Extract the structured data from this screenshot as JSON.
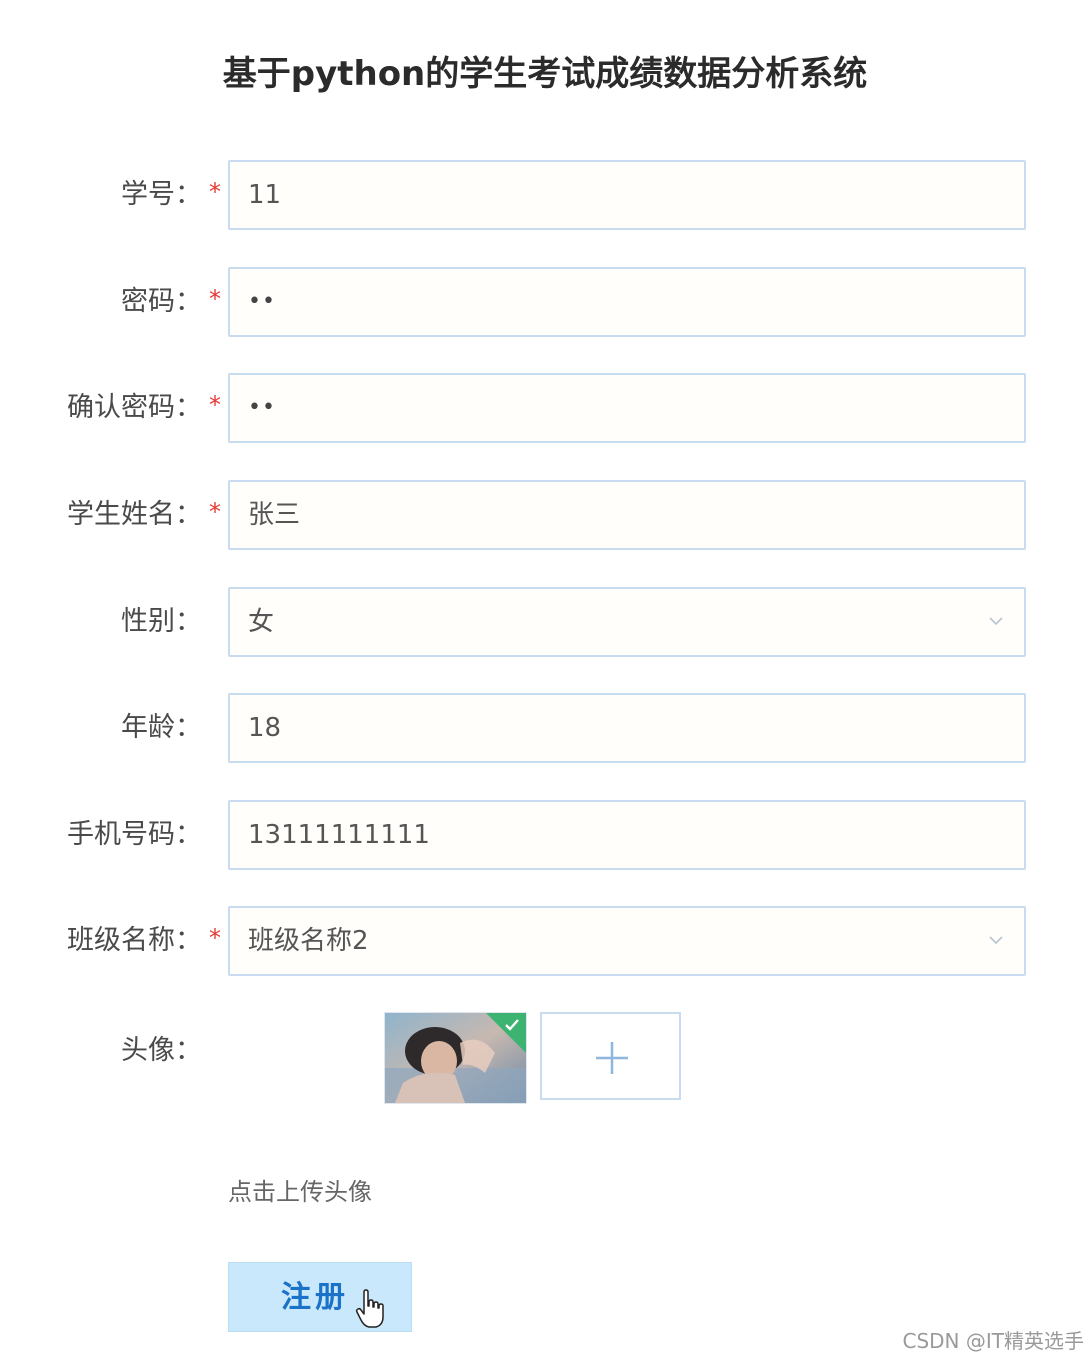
{
  "title": "基于python的学生考试成绩数据分析系统",
  "form": {
    "fields": [
      {
        "label": "学号：",
        "required": true,
        "value": "11",
        "type": "text"
      },
      {
        "label": "密码：",
        "required": true,
        "value": "••",
        "type": "password"
      },
      {
        "label": "确认密码：",
        "required": true,
        "value": "••",
        "type": "password"
      },
      {
        "label": "学生姓名：",
        "required": true,
        "value": "张三",
        "type": "text"
      },
      {
        "label": "性别：",
        "required": false,
        "value": "女",
        "type": "select"
      },
      {
        "label": "年龄：",
        "required": false,
        "value": "18",
        "type": "text"
      },
      {
        "label": "手机号码：",
        "required": false,
        "value": "13111111111",
        "type": "text"
      },
      {
        "label": "班级名称：",
        "required": true,
        "value": "班级名称2",
        "type": "select"
      }
    ],
    "required_mark": "*",
    "avatar": {
      "label": "头像：",
      "upload_hint": "点击上传头像",
      "status_icon": "check-icon",
      "add_icon": "plus-icon"
    },
    "register_label": "注册"
  },
  "watermark": "CSDN @IT精英选手",
  "colors": {
    "accent": "#1a73c9",
    "button_bg": "#c9e8fb",
    "border": "#c9dcef",
    "required": "#e53935",
    "success": "#3cb371"
  }
}
